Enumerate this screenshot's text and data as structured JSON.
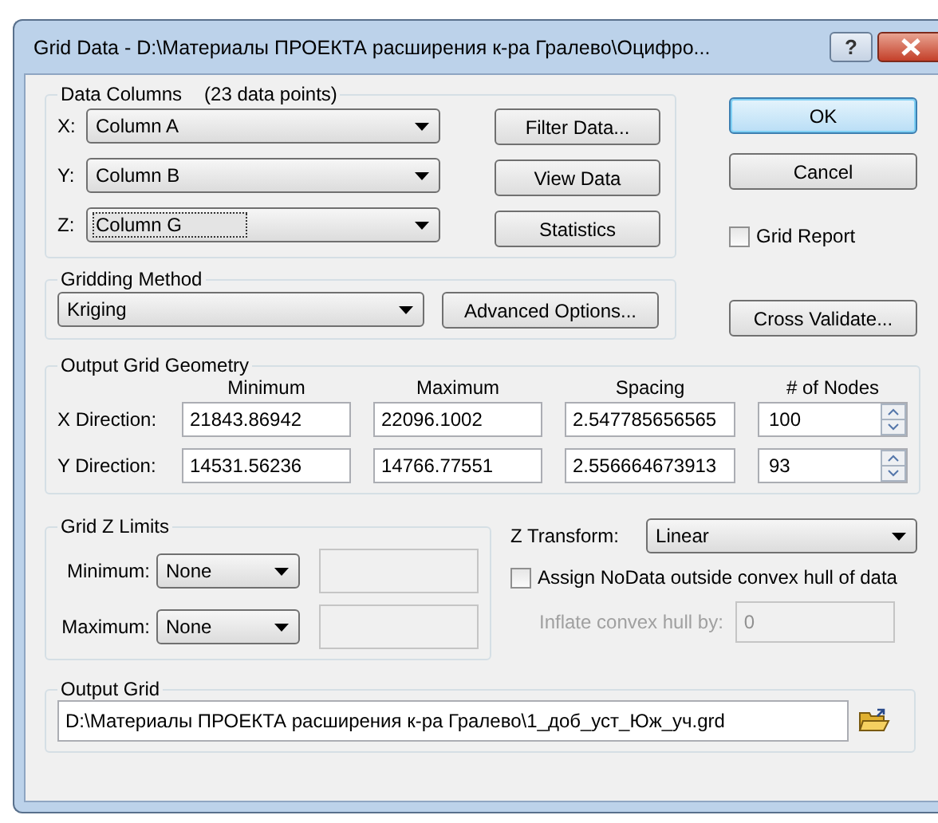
{
  "window": {
    "title": "Grid Data - D:\\Материалы ПРОЕКТА расширения к-ра Гралево\\Оцифро...",
    "help": "?"
  },
  "data_columns": {
    "title": "Data Columns",
    "note": "(23 data points)",
    "rows": [
      {
        "label": "X:",
        "value": "Column A",
        "focused": false
      },
      {
        "label": "Y:",
        "value": "Column B",
        "focused": false
      },
      {
        "label": "Z:",
        "value": "Column G",
        "focused": true
      }
    ],
    "buttons": [
      "Filter Data...",
      "View Data",
      "Statistics"
    ]
  },
  "ok_button": {
    "label": "OK",
    "default": true
  },
  "cancel_button": {
    "label": "Cancel"
  },
  "grid_report": {
    "label": "Grid Report",
    "checked": false
  },
  "gridding_method": {
    "title": "Gridding Method",
    "value": "Kriging",
    "options_button": "Advanced Options..."
  },
  "cross_validate_button": "Cross Validate...",
  "output_grid_geometry": {
    "title": "Output Grid Geometry",
    "columns": [
      "Minimum",
      "Maximum",
      "Spacing",
      "# of Nodes"
    ],
    "rows": [
      {
        "label": "X Direction:",
        "minimum": "21843.86942",
        "maximum": "22096.1002",
        "spacing": "2.547785656565",
        "nodes": "100"
      },
      {
        "label": "Y Direction:",
        "minimum": "14531.56236",
        "maximum": "14766.77551",
        "spacing": "2.556664673913",
        "nodes": "93"
      }
    ]
  },
  "grid_z_limits": {
    "title": "Grid Z Limits",
    "rows": [
      {
        "label": "Minimum:",
        "mode": "None",
        "disabled": true
      },
      {
        "label": "Maximum:",
        "mode": "None",
        "disabled": true
      }
    ]
  },
  "z_transform": {
    "label": "Z Transform:",
    "value": "Linear"
  },
  "assign_nodata": {
    "label": "Assign NoData outside convex hull of data",
    "checked": false
  },
  "inflate": {
    "label": "Inflate convex hull by:",
    "value": "0",
    "disabled": true
  },
  "output_grid": {
    "title": "Output Grid",
    "path": "D:\\Материалы ПРОЕКТА расширения к-ра Гралево\\1_доб_уст_Юж_уч.grd"
  }
}
